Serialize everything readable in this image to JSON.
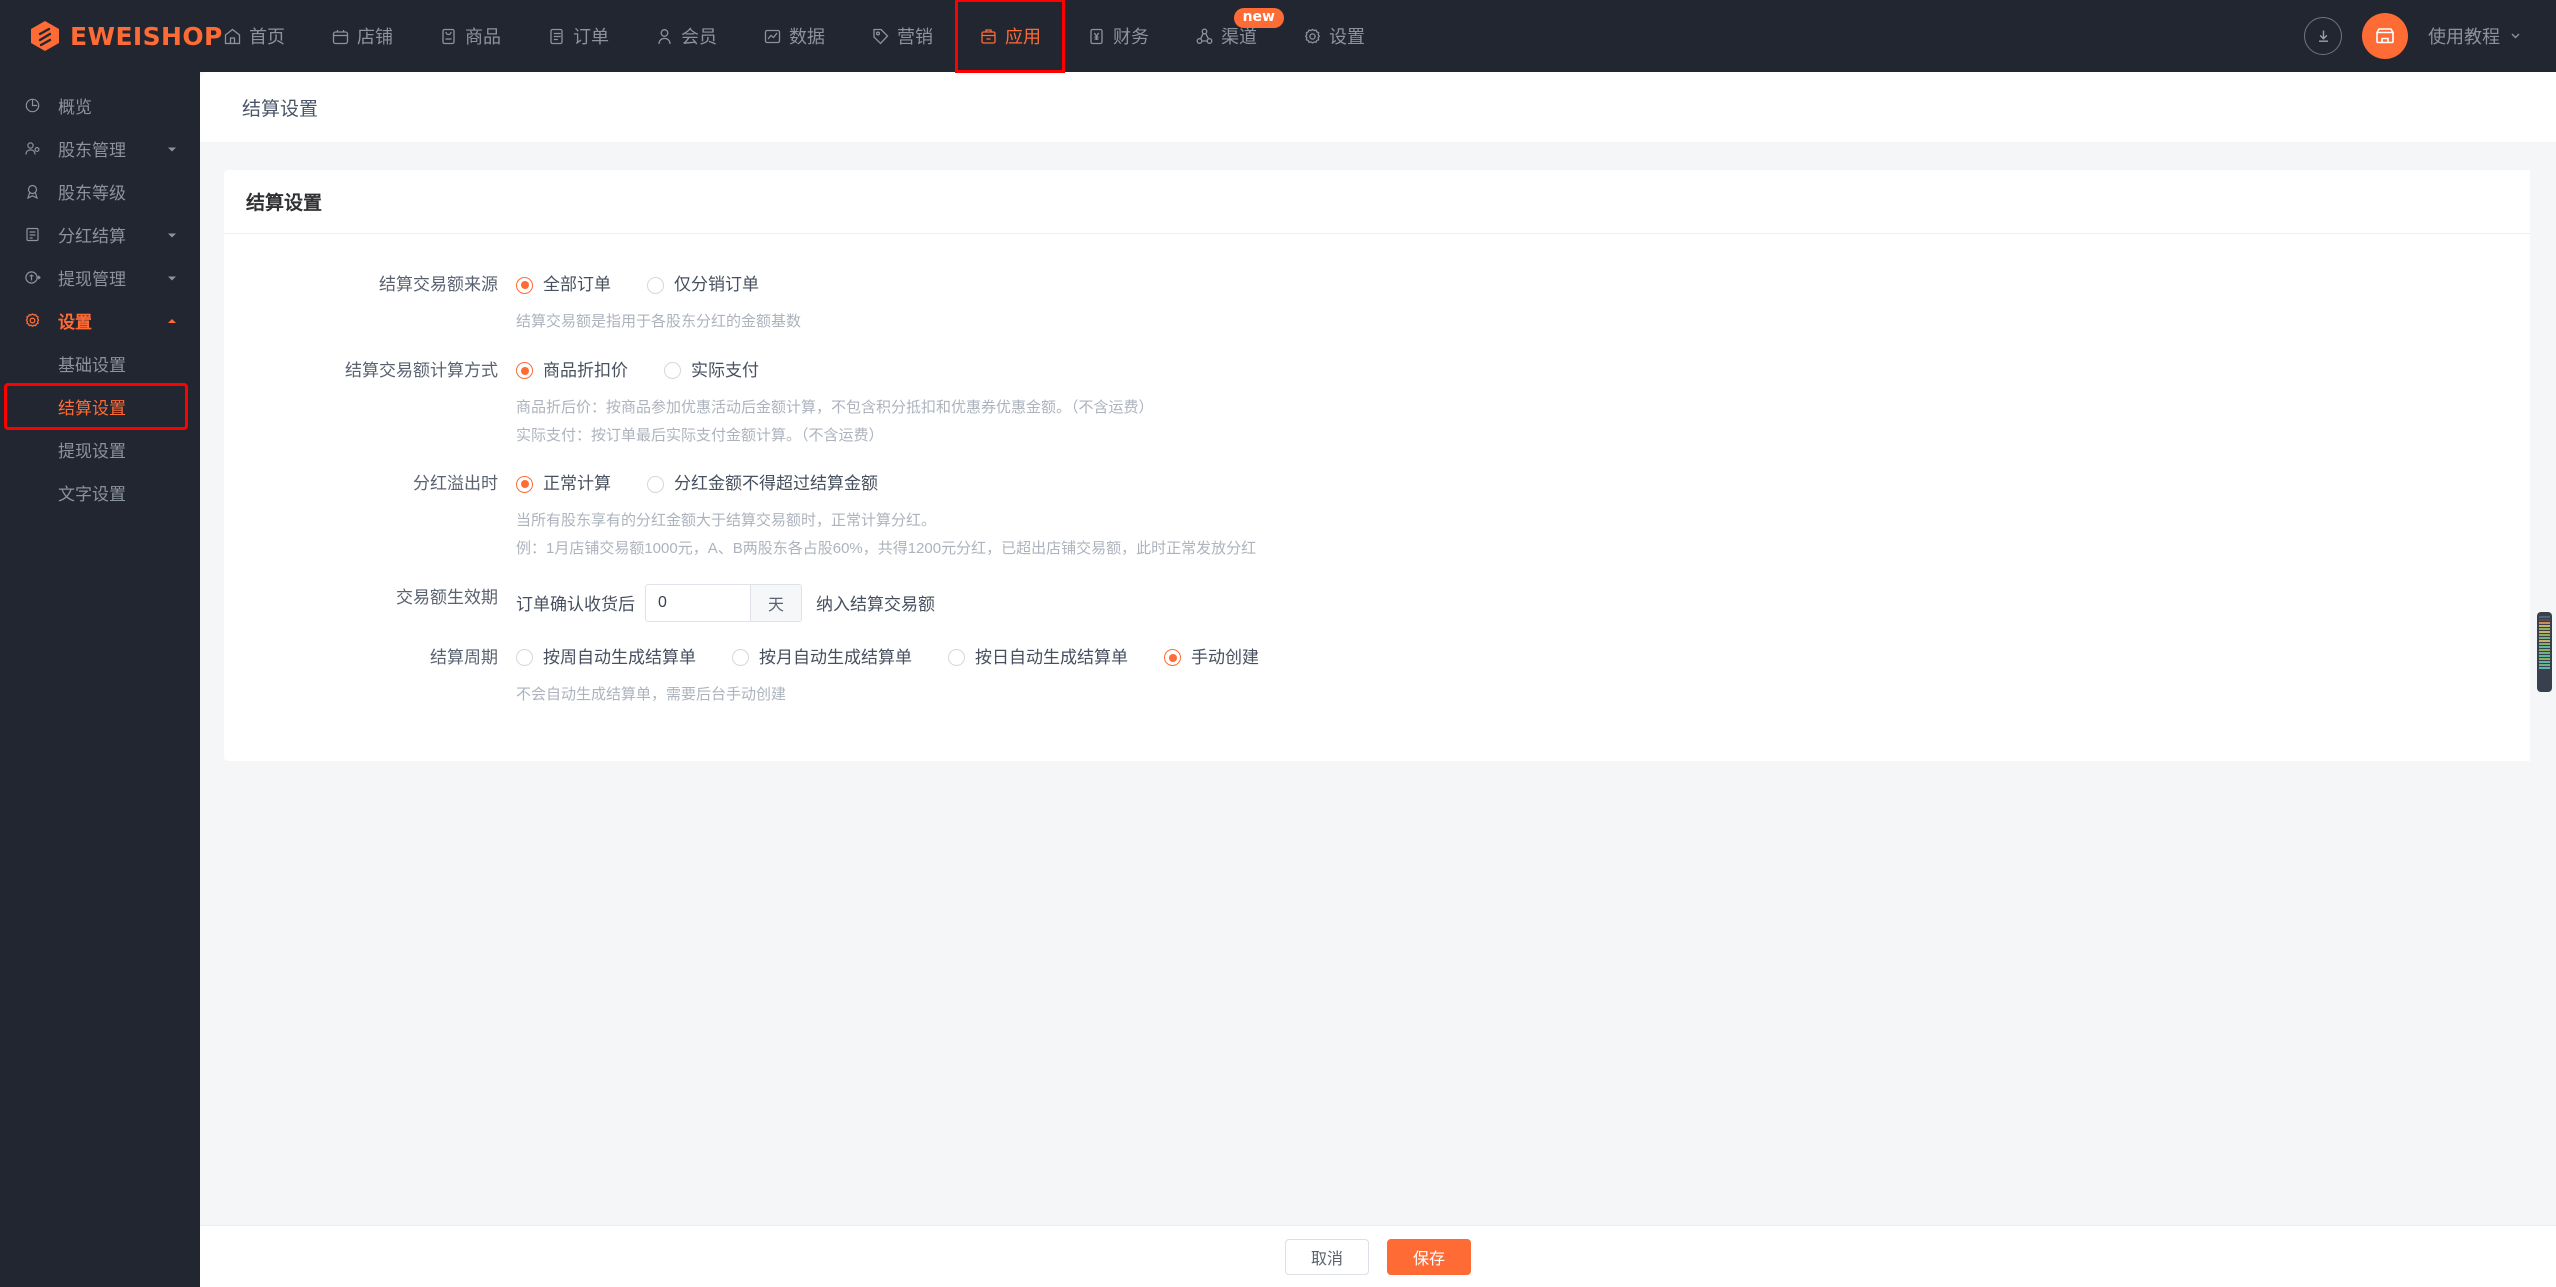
{
  "brand": {
    "name": "EWEISHOP",
    "logo_icon": "eweishop-logo-icon"
  },
  "topnav": {
    "items": [
      {
        "label": "首页",
        "icon": "home-icon",
        "active": false
      },
      {
        "label": "店铺",
        "icon": "store-icon",
        "active": false
      },
      {
        "label": "商品",
        "icon": "goods-icon",
        "active": false
      },
      {
        "label": "订单",
        "icon": "order-icon",
        "active": false
      },
      {
        "label": "会员",
        "icon": "member-icon",
        "active": false
      },
      {
        "label": "数据",
        "icon": "chart-icon",
        "active": false
      },
      {
        "label": "营销",
        "icon": "tag-icon",
        "active": false
      },
      {
        "label": "应用",
        "icon": "apps-icon",
        "active": true,
        "highlighted": true
      },
      {
        "label": "财务",
        "icon": "finance-icon",
        "active": false
      },
      {
        "label": "渠道",
        "icon": "channel-icon",
        "active": false,
        "badge": "new"
      },
      {
        "label": "设置",
        "icon": "gear-icon",
        "active": false
      }
    ],
    "download_icon": "download-icon",
    "avatar_icon": "shop-avatar-icon",
    "tutorial_label": "使用教程",
    "tutorial_caret": "chevron-down-icon"
  },
  "sidebar": {
    "items": [
      {
        "label": "概览",
        "icon": "overview-icon",
        "expandable": false,
        "active": false
      },
      {
        "label": "股东管理",
        "icon": "shareholder-icon",
        "expandable": true,
        "expanded": false,
        "active": false
      },
      {
        "label": "股东等级",
        "icon": "level-icon",
        "expandable": false,
        "active": false
      },
      {
        "label": "分红结算",
        "icon": "dividend-icon",
        "expandable": true,
        "expanded": false,
        "active": false
      },
      {
        "label": "提现管理",
        "icon": "withdraw-icon",
        "expandable": true,
        "expanded": false,
        "active": false
      },
      {
        "label": "设置",
        "icon": "gear-icon",
        "expandable": true,
        "expanded": true,
        "active": true
      }
    ],
    "subitems": [
      {
        "label": "基础设置",
        "active": false,
        "highlighted": false
      },
      {
        "label": "结算设置",
        "active": true,
        "highlighted": true
      },
      {
        "label": "提现设置",
        "active": false,
        "highlighted": false
      },
      {
        "label": "文字设置",
        "active": false,
        "highlighted": false
      }
    ]
  },
  "page": {
    "breadcrumb": "结算设置",
    "card_title": "结算设置"
  },
  "form": {
    "source": {
      "label": "结算交易额来源",
      "options": [
        {
          "label": "全部订单",
          "checked": true
        },
        {
          "label": "仅分销订单",
          "checked": false
        }
      ],
      "hints": [
        "结算交易额是指用于各股东分红的金额基数"
      ]
    },
    "calc_method": {
      "label": "结算交易额计算方式",
      "options": [
        {
          "label": "商品折扣价",
          "checked": true
        },
        {
          "label": "实际支付",
          "checked": false
        }
      ],
      "hints": [
        "商品折后价：按商品参加优惠活动后金额计算，不包含积分抵扣和优惠券优惠金额。（不含运费）",
        "实际支付：按订单最后实际支付金额计算。（不含运费）"
      ]
    },
    "overflow": {
      "label": "分红溢出时",
      "options": [
        {
          "label": "正常计算",
          "checked": true
        },
        {
          "label": "分红金额不得超过结算金额",
          "checked": false
        }
      ],
      "hints": [
        "当所有股东享有的分红金额大于结算交易额时，正常计算分红。",
        "例：1月店铺交易额1000元，A、B两股东各占股60%，共得1200元分红，已超出店铺交易额，此时正常发放分红"
      ]
    },
    "effective_period": {
      "label": "交易额生效期",
      "prefix": "订单确认收货后",
      "value": "0",
      "placeholder": "0",
      "unit": "天",
      "suffix": "纳入结算交易额"
    },
    "cycle": {
      "label": "结算周期",
      "options": [
        {
          "label": "按周自动生成结算单",
          "checked": false
        },
        {
          "label": "按月自动生成结算单",
          "checked": false
        },
        {
          "label": "按日自动生成结算单",
          "checked": false
        },
        {
          "label": "手动创建",
          "checked": true
        }
      ],
      "hints": [
        "不会自动生成结算单，需要后台手动创建"
      ]
    }
  },
  "footer": {
    "cancel_label": "取消",
    "save_label": "保存"
  },
  "colors": {
    "accent": "#ff6b35",
    "header_bg": "#212630",
    "page_bg": "#f5f6f8",
    "highlight_box": "#ff0000"
  }
}
